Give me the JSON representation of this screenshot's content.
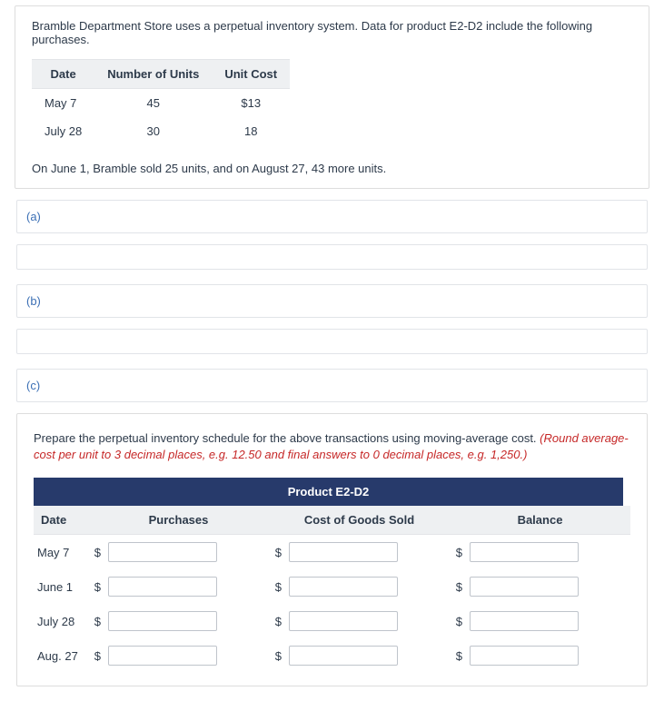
{
  "intro": "Bramble Department Store uses a perpetual inventory system. Data for product E2-D2 include the following purchases.",
  "purchase_table": {
    "headers": [
      "Date",
      "Number of Units",
      "Unit Cost"
    ],
    "rows": [
      {
        "date": "May 7",
        "units": "45",
        "cost": "$13"
      },
      {
        "date": "July 28",
        "units": "30",
        "cost": "18"
      }
    ]
  },
  "sales_text": "On June 1, Bramble sold 25 units, and on August 27, 43 more units.",
  "parts": {
    "a": "(a)",
    "b": "(b)",
    "c": "(c)"
  },
  "part_c": {
    "instruction_main": "Prepare the perpetual inventory schedule for the above transactions using moving-average cost. ",
    "instruction_red": "(Round average-cost per unit to 3 decimal places, e.g. 12.50 and final answers to 0 decimal places, e.g. 1,250.)",
    "product_title": "Product E2-D2",
    "col_headers": [
      "Date",
      "Purchases",
      "Cost of Goods Sold",
      "Balance"
    ],
    "row_dates": [
      "May 7",
      "June 1",
      "July 28",
      "Aug. 27"
    ],
    "dollar": "$"
  }
}
